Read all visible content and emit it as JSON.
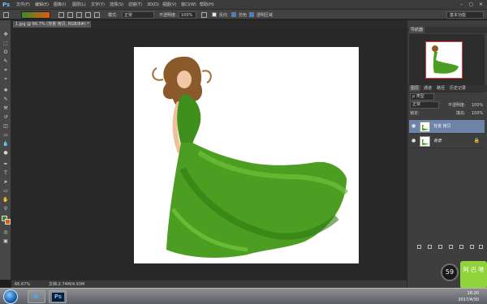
{
  "app": {
    "logo": "Ps"
  },
  "menubar": {
    "items": [
      "文件(F)",
      "编辑(E)",
      "图像(I)",
      "图层(L)",
      "文字(Y)",
      "选择(S)",
      "滤镜(T)",
      "3D(D)",
      "视图(V)",
      "窗口(W)",
      "帮助(H)"
    ],
    "controls": [
      "–",
      "▢",
      "✕"
    ]
  },
  "options": {
    "mode_label": "模式:",
    "mode_value": "正常",
    "opacity_label": "不透明度:",
    "opacity_value": "100%",
    "reverse_label": "反向",
    "dither_label": "仿色",
    "transparency_label": "透明区域",
    "workspace_value": "基本功能",
    "gradient_colors": [
      "#3d8b2c",
      "#e05a12"
    ]
  },
  "document": {
    "tab_title": "1.jpg @ 66.7% (背景 拷贝, RGB/8#) *"
  },
  "toolbar": {
    "tools": [
      "move-icon",
      "marquee-icon",
      "lasso-icon",
      "quick-select-icon",
      "crop-icon",
      "eyedropper-icon",
      "healing-icon",
      "brush-icon",
      "stamp-icon",
      "history-brush-icon",
      "eraser-icon",
      "gradient-icon",
      "blur-icon",
      "dodge-icon",
      "pen-icon",
      "type-icon",
      "path-select-icon",
      "shape-icon",
      "hand-icon",
      "zoom-icon"
    ],
    "glyphs": [
      "✥",
      "⬚",
      "ʘ",
      "✎",
      "⌗",
      "⌖",
      "✚",
      "✎",
      "⚒",
      "↺",
      "◫",
      "▭",
      "💧",
      "●",
      "✒",
      "T",
      "➤",
      "▭",
      "✋",
      "⚲"
    ],
    "fg_color": "#3d8b2c",
    "bg_color": "#e05a12"
  },
  "status": {
    "zoom": "66.67%",
    "doc_size": "文档:2.74M/4.93M"
  },
  "panels": {
    "navigator_tabs": [
      "导航器"
    ],
    "layers_tabs": [
      "图层",
      "通道",
      "路径",
      "历史记录"
    ],
    "filter_label": "ρ 类型",
    "blend_mode": "正常",
    "opacity_label": "不透明度:",
    "opacity_value": "100%",
    "lock_label": "锁定:",
    "fill_label": "填充:",
    "fill_value": "100%",
    "layers": [
      {
        "name": "背景 拷贝",
        "selected": true,
        "locked": false
      },
      {
        "name": "背景",
        "selected": false,
        "locked": true
      }
    ]
  },
  "taskbar": {
    "apps": [
      "ie-icon",
      "folder-icon",
      "photoshop-icon"
    ],
    "time": "16:20",
    "date": "2017/4/30"
  },
  "overlays": {
    "speed_badge": "59",
    "widget_text": "阿 巴 嗒"
  }
}
